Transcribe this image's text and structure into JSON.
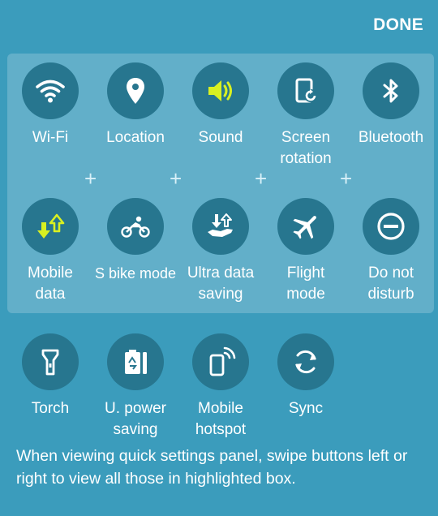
{
  "header": {
    "done_label": "DONE"
  },
  "highlighted_tiles": [
    {
      "label": "Wi-Fi",
      "icon": "wifi-icon",
      "active": false
    },
    {
      "label": "Location",
      "icon": "location-pin-icon",
      "active": false
    },
    {
      "label": "Sound",
      "icon": "speaker-icon",
      "active": true
    },
    {
      "label": "Screen\nrotation",
      "icon": "screen-rotation-icon",
      "active": false
    },
    {
      "label": "Bluetooth",
      "icon": "bluetooth-icon",
      "active": false
    },
    {
      "label": "Mobile\ndata",
      "icon": "mobile-data-arrows-icon",
      "active": true
    },
    {
      "label": "S bike mode",
      "icon": "motorbike-icon",
      "active": false
    },
    {
      "label": "Ultra data\nsaving",
      "icon": "ultra-data-saving-icon",
      "active": false
    },
    {
      "label": "Flight\nmode",
      "icon": "airplane-icon",
      "active": false
    },
    {
      "label": "Do not\ndisturb",
      "icon": "do-not-disturb-icon",
      "active": false
    }
  ],
  "other_tiles": [
    {
      "label": "Torch",
      "icon": "torch-icon",
      "active": false
    },
    {
      "label": "U. power\nsaving",
      "icon": "power-saving-icon",
      "active": false
    },
    {
      "label": "Mobile\nhotspot",
      "icon": "mobile-hotspot-icon",
      "active": false
    },
    {
      "label": "Sync",
      "icon": "sync-icon",
      "active": false
    }
  ],
  "hint_text": "When viewing quick settings panel, swipe buttons left or right to view all those in highlighted box.",
  "colors": {
    "background": "#3b9cbc",
    "tile_circle": "#27768f",
    "active_icon": "#d9f021",
    "inactive_icon": "#ffffff"
  }
}
